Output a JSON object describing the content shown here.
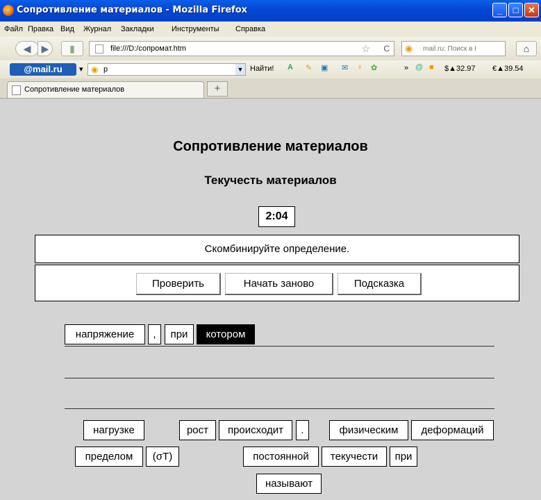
{
  "window": {
    "title": "Сопротивление материалов - Mozilla Firefox"
  },
  "menu": [
    "Файл",
    "Правка",
    "Вид",
    "Журнал",
    "Закладки",
    "Инструменты",
    "Справка"
  ],
  "nav": {
    "url": "file:///D:/сопромат.htm",
    "search_placeholder": "mail.ru: Поиск в I"
  },
  "mailbar": {
    "logo": "@mail.ru",
    "query": "р",
    "find_label": "Найти!",
    "dollar": "$▲32.97",
    "euro": "€▲39.54"
  },
  "tab": {
    "label": "Сопротивление материалов"
  },
  "page": {
    "title": "Сопротивление материалов",
    "subtitle": "Текучесть материалов",
    "timer": "2:04",
    "instruction": "Скомбинируйте определение.",
    "buttons": {
      "check": "Проверить",
      "restart": "Начать заново",
      "hint": "Подсказка"
    },
    "answer_words": [
      "напряжение",
      ",",
      "при",
      "котором"
    ],
    "pool_words": [
      "нагрузке",
      "рост",
      "происходит",
      ".",
      "физическим",
      "деформаций",
      "пределом",
      "(σТ)",
      "постоянной",
      "текучести",
      "при",
      "называют"
    ]
  }
}
